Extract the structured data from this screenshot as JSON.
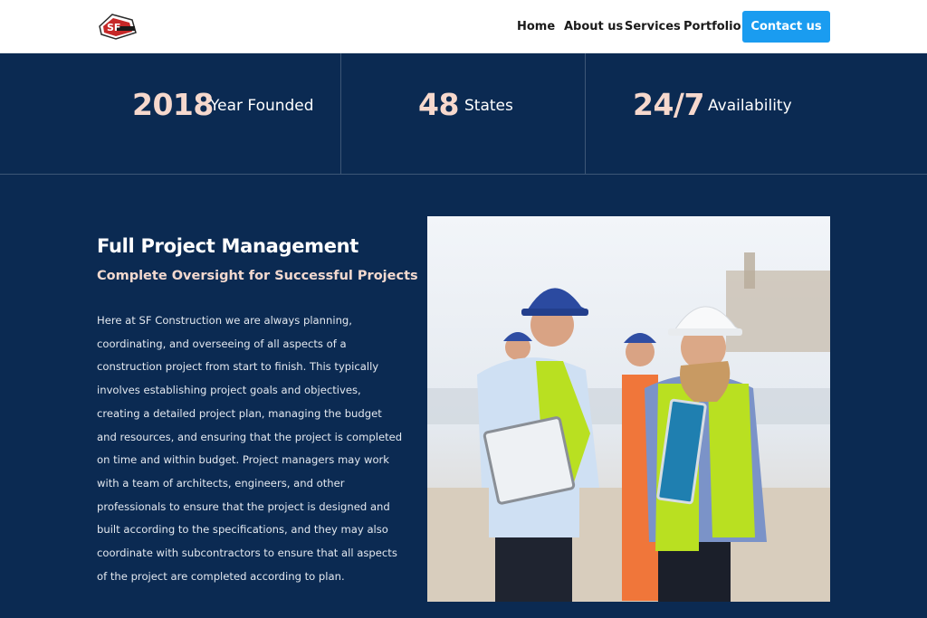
{
  "header": {
    "logo": {
      "icon": "sf-construction-logo",
      "text": "SF"
    },
    "nav": [
      {
        "label": "Home"
      },
      {
        "label": "About us"
      },
      {
        "label": "Services"
      },
      {
        "label": "Portfolio"
      }
    ],
    "cta_label": "Contact us",
    "cta_color": "#1a9cf0"
  },
  "stats": [
    {
      "value": "2018",
      "label": "Year Founded"
    },
    {
      "value": "48",
      "label": "States"
    },
    {
      "value": "24/7",
      "label": "Availability"
    }
  ],
  "section": {
    "title": "Full Project Management",
    "subtitle": "Complete Oversight for Successful Projects",
    "body": "Here at SF Construction we are always planning, coordinating, and overseeing of all aspects of a construction project from start to finish. This typically involves establishing project goals and objectives, creating a detailed project plan, managing the budget and resources, and ensuring that the project is completed on time and within budget. Project managers may work with a team of architects, engineers, and other professionals to ensure that the project is designed and built according to the specifications, and they may also coordinate with subcontractors to ensure that all aspects of the project are completed according to plan."
  },
  "colors": {
    "background": "#0b2a52",
    "accent_number": "#f6d8cd",
    "subtitle": "#f3d9cf"
  }
}
